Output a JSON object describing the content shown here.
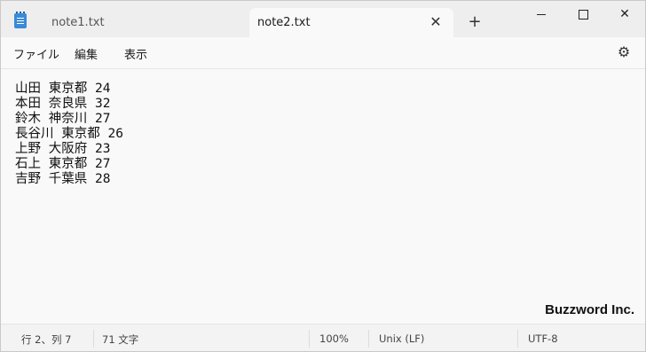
{
  "tabs": [
    {
      "label": "note1.txt",
      "active": false
    },
    {
      "label": "note2.txt",
      "active": true
    }
  ],
  "icons": {
    "app": "notepad-icon",
    "close_tab": "close-icon",
    "new_tab": "plus-icon",
    "settings": "gear-icon"
  },
  "menu": {
    "file": "ファイル",
    "edit": "編集",
    "view": "表示"
  },
  "editor": {
    "lines": [
      "山田 東京都 24",
      "本田 奈良県 32",
      "鈴木 神奈川 27",
      "長谷川 東京都 26",
      "上野 大阪府 23",
      "石上 東京都 27",
      "吉野 千葉県 28"
    ]
  },
  "watermark": "Buzzword Inc.",
  "status": {
    "position": "行 2、列 7",
    "char_count": "71 文字",
    "zoom": "100%",
    "line_ending": "Unix (LF)",
    "encoding": "UTF-8"
  }
}
